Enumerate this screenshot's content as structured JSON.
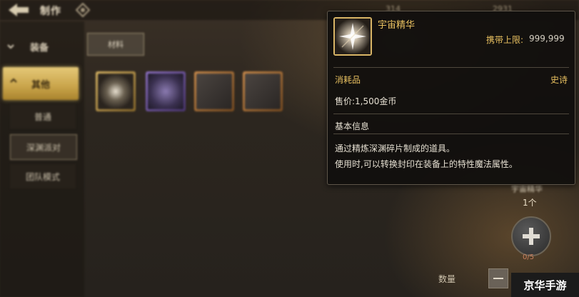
{
  "topbar": {
    "title": "制作",
    "stat_1": "314",
    "stat_2": "2931"
  },
  "sidebar": {
    "category": "装备",
    "active_category": "其他",
    "sub_items": [
      "普通",
      "深渊派对",
      "团队模式"
    ]
  },
  "content": {
    "tab": "材料"
  },
  "tooltip": {
    "item_name": "宇宙精华",
    "carry_limit_label": "携带上限:",
    "carry_limit_value": "999,999",
    "item_type": "消耗品",
    "rarity": "史诗",
    "price": "售价:1,500金币",
    "section_title": "基本信息",
    "desc_line_1": "通过精炼深渊碎片制成的道具。",
    "desc_line_2": "使用时,可以转换封印在装备上的特性魔法属性。"
  },
  "panel": {
    "upper_label": "宇宙精华",
    "count": "1个",
    "add_count": "0/5",
    "qty_label": "数量"
  },
  "watermark": "京华手游",
  "colors": {
    "gold_text": "#e8c060",
    "active_tab": "#d2ae58"
  }
}
